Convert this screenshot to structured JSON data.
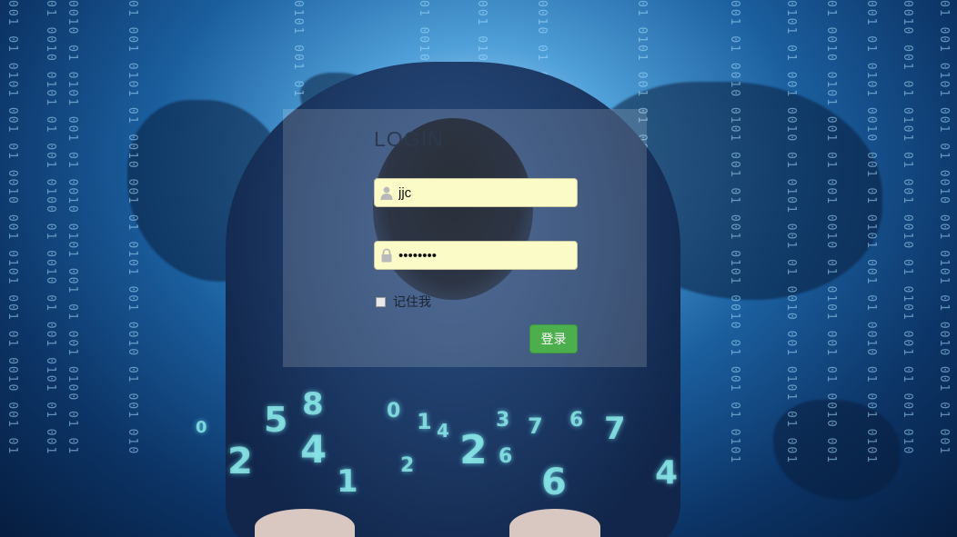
{
  "login": {
    "title": "LOGIN",
    "username": {
      "value": "jjc",
      "icon": "user-icon"
    },
    "password": {
      "value": "********",
      "icon": "lock-icon"
    },
    "remember": {
      "label": "记住我",
      "checked": false
    },
    "submit_label": "登录"
  },
  "colors": {
    "field_background": "#fbfbc7",
    "submit_button": "#4cae4c",
    "title_text": "#2b3a4e"
  }
}
